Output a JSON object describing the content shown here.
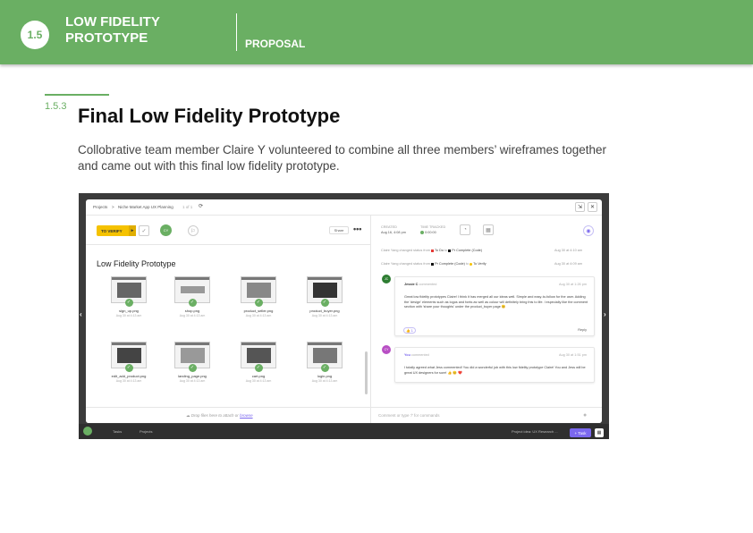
{
  "header": {
    "section_number": "1.5",
    "section_title": "LOW FIDELITY PROTOTYPE",
    "subsection": "PROPOSAL"
  },
  "content": {
    "number": "1.5.3",
    "title": "Final Low Fidelity Prototype",
    "paragraph": "Collobrative team member Claire Y volunteered to combine all three members’ wireframes together and came out with this final low fidelity prototype."
  },
  "screenshot": {
    "breadcrumb": [
      "Projects",
      ">",
      "Niche Market App UX Planning",
      "1 of 1"
    ],
    "status_button": "TO VERIFY",
    "share_label": "Share",
    "more_label": "•••",
    "created_label": "CREATED",
    "created_value": "Aug 16, 4:08 pm",
    "time_tracked_label": "TIME TRACKED",
    "time_tracked_value": "0:00:00",
    "panel_title": "Low Fidelity Prototype",
    "files": [
      {
        "name": "sign_up.png",
        "date": "Aug 30 at 4:13 am"
      },
      {
        "name": "shop.png",
        "date": "Aug 30 at 4:13 am"
      },
      {
        "name": "product_seller.png",
        "date": "Aug 30 at 4:13 am"
      },
      {
        "name": "product_buyer.png",
        "date": "Aug 30 at 4:13 am"
      },
      {
        "name": "edit_add_product.png",
        "date": "Aug 30 at 4:13 am"
      },
      {
        "name": "landing_page.png",
        "date": "Aug 30 at 4:13 am"
      },
      {
        "name": "cart.png",
        "date": "Aug 30 at 4:13 am"
      },
      {
        "name": "login.png",
        "date": "Aug 30 at 4:13 am"
      }
    ],
    "activity": [
      {
        "text_a": "Claire Yang changed status from",
        "from": "To Do",
        "to_word": "to",
        "to": "Pr Complete (Code)",
        "time": "Aug 30 at 4:10 am",
        "from_color": "#e53935",
        "to_color": "#111111"
      },
      {
        "text_a": "Claire Yang changed status from",
        "from": "Pr Complete (Code)",
        "to_word": "to",
        "to": "To Verify",
        "time": "Aug 30 at 4:09 am",
        "from_color": "#111111",
        "to_color": "#f5c200"
      }
    ],
    "comment1": {
      "initials": "JC",
      "author": "Jessie C",
      "action": "commented",
      "time": "Aug 30 at 1:26 pm",
      "body": "Great low fidelity prototypes Claire! I think it has merged all our ideas well. Simple and easy-to-follow for the user. Adding the 'design' elements such as logos and fonts as well as colour will definitely bring this to life. I especially like the comment section with 'share your thoughts' under the product_buyer page 😊",
      "reaction": "👍 1",
      "reply": "Reply"
    },
    "comment2": {
      "initials": "CY",
      "author": "You",
      "action": "commented",
      "time": "Aug 30 at 1:51 pm",
      "body": "I totally agreed what Jess commented! You did a wonderful job with this low fidelity prototype Claire! You and Jess will be great UX designers for sure! 👍 😊 ❤️"
    },
    "drop_text": "Drop files here to attach or",
    "drop_link": "browse",
    "comment_placeholder": "Comment or type '/' for commands",
    "task_button": "+ Task",
    "footer_items": [
      "Tasks",
      "Projects",
      "Project idea: UX Research ..."
    ]
  },
  "colors": {
    "brand_green": "#6aaf63",
    "status_yellow": "#f5c200",
    "accent_purple": "#7b68ee"
  }
}
